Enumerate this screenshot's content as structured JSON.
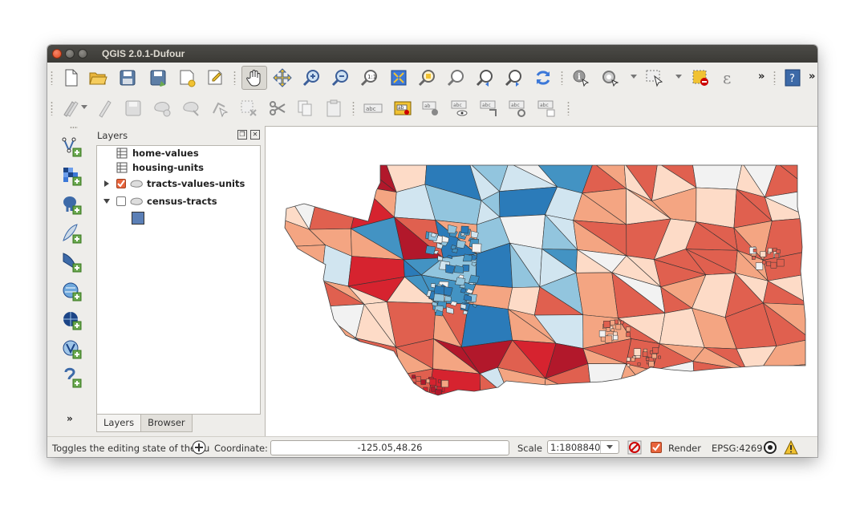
{
  "window": {
    "title": "QGIS 2.0.1-Dufour"
  },
  "toolbar1": {
    "buttons": [
      "new-project",
      "open-project",
      "save-project",
      "save-as",
      "new-print-composer",
      "composer-manager",
      "pan",
      "pan-to-selection",
      "zoom-in",
      "zoom-out",
      "zoom-native",
      "zoom-full",
      "zoom-to-selection",
      "zoom-to-layer",
      "zoom-last",
      "zoom-next",
      "refresh",
      "identify",
      "run-action",
      "select-features",
      "deselect-all",
      "measure",
      "help"
    ]
  },
  "toolbar2": {
    "buttons": [
      "current-edits",
      "toggle-editing",
      "save-edits",
      "add-feature",
      "move-feature",
      "node-tool",
      "delete-selected",
      "cut-features",
      "copy-features",
      "paste-features",
      "label-toolbar",
      "layer-labeling",
      "pin-labels",
      "show-hide-labels",
      "move-label",
      "rotate-label",
      "change-label"
    ]
  },
  "layers_panel": {
    "title": "Layers",
    "layers": [
      {
        "name": "home-values",
        "type": "table",
        "checked": null
      },
      {
        "name": "housing-units",
        "type": "table",
        "checked": null
      },
      {
        "name": "tracts-values-units",
        "type": "polygon",
        "checked": true,
        "expanded": false
      },
      {
        "name": "census-tracts",
        "type": "polygon",
        "checked": false,
        "expanded": true,
        "legend_color": "#5b7fb6"
      }
    ],
    "tabs": [
      "Layers",
      "Browser"
    ]
  },
  "statusbar": {
    "message": "Toggles the editing state of the cu",
    "coordinate_label": "Coordinate:",
    "coordinate_value": "-125.05,48.26",
    "scale_label": "Scale",
    "scale_value": "1:1808840",
    "render_label": "Render",
    "render_checked": true,
    "crs": "EPSG:4269"
  },
  "map": {
    "palette": [
      "#b2182b",
      "#d6232f",
      "#e0604f",
      "#f4a582",
      "#fddbc7",
      "#f2f2f2",
      "#d1e5f0",
      "#92c5de",
      "#4393c3",
      "#2b7bb9"
    ]
  }
}
